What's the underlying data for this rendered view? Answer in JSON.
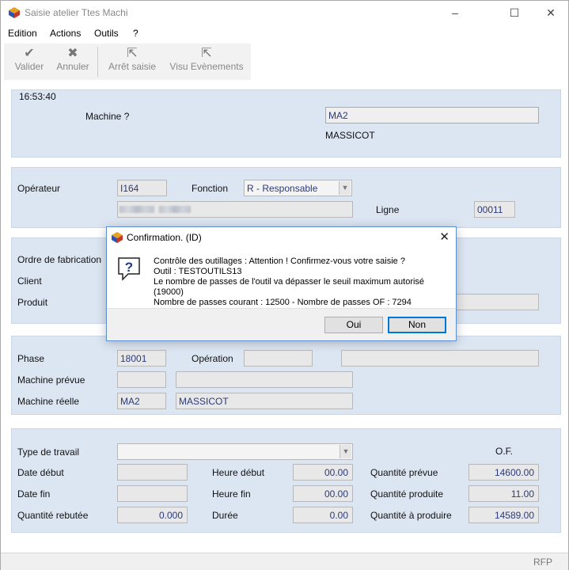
{
  "window": {
    "title": "Saisie atelier Ttes Machi",
    "controls": {
      "minimize": "–",
      "maximize": "☐",
      "close": "✕"
    }
  },
  "menu": [
    "Edition",
    "Actions",
    "Outils",
    "?"
  ],
  "toolbar": {
    "validate": "Valider",
    "cancel": "Annuler",
    "stop": "Arrêt saisie",
    "events": "Visu Evènements"
  },
  "header": {
    "time": "16:53:40",
    "machine_label": "Machine ?",
    "machine_value": "MA2",
    "machine_desc": "MASSICOT"
  },
  "operator": {
    "label": "Opérateur",
    "value": "I164",
    "fonction_label": "Fonction",
    "fonction_value": "R - Responsable",
    "ligne_label": "Ligne",
    "ligne_value": "00011"
  },
  "order": {
    "of_label": "Ordre de fabrication",
    "client_label": "Client",
    "produit_label": "Produit"
  },
  "phase": {
    "phase_label": "Phase",
    "phase_value": "18001",
    "operation_label": "Opération",
    "machine_prevue_label": "Machine prévue",
    "machine_reelle_label": "Machine réelle",
    "machine_reelle_code": "MA2",
    "machine_reelle_desc": "MASSICOT"
  },
  "work": {
    "type_label": "Type de travail",
    "of_header": "O.F.",
    "date_debut_label": "Date début",
    "date_fin_label": "Date fin",
    "qte_rebutee_label": "Quantité rebutée",
    "qte_rebutee_value": "0.000",
    "heure_debut_label": "Heure début",
    "heure_debut_value": "00.00",
    "heure_fin_label": "Heure fin",
    "heure_fin_value": "00.00",
    "duree_label": "Durée",
    "duree_value": "0.00",
    "qte_prevue_label": "Quantité prévue",
    "qte_prevue_value": "14600.00",
    "qte_produite_label": "Quantité produite",
    "qte_produite_value": "11.00",
    "qte_a_produire_label": "Quantité à produire",
    "qte_a_produire_value": "14589.00"
  },
  "status": {
    "text": "RFP"
  },
  "dialog": {
    "title": "Confirmation.   (ID)",
    "line1": "Contrôle des outillages : Attention ! Confirmez-vous votre saisie ?",
    "line2": "Outil : TESTOUTILS13",
    "line3": "Le nombre de passes de l'outil va dépasser le seuil maximum autorisé (19000)",
    "line4": "Nombre de passes courant : 12500 - Nombre de passes OF : 7294",
    "yes": "Oui",
    "no": "Non"
  }
}
